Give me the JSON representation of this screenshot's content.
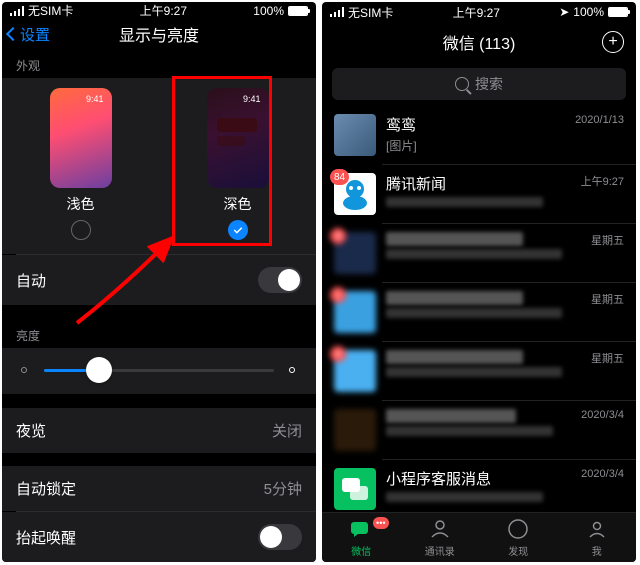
{
  "left": {
    "status": {
      "carrier": "无SIM卡",
      "time": "上午9:27",
      "battery": "100%"
    },
    "nav": {
      "back": "设置",
      "title": "显示与亮度"
    },
    "appearance": {
      "section": "外观",
      "light": {
        "label": "浅色",
        "time": "9:41"
      },
      "dark": {
        "label": "深色",
        "time": "9:41"
      }
    },
    "auto_row": "自动",
    "brightness_section": "亮度",
    "night_shift": {
      "label": "夜览",
      "value": "关闭"
    },
    "auto_lock": {
      "label": "自动锁定",
      "value": "5分钟"
    },
    "raise_to_wake": "抬起唤醒"
  },
  "right": {
    "status": {
      "carrier": "无SIM卡",
      "time": "上午9:27",
      "battery": "100%"
    },
    "nav_title": "微信 (113)",
    "search_placeholder": "搜索",
    "chats": [
      {
        "name": "鸾鸾",
        "sub": "[图片]",
        "time": "2020/1/13",
        "avatar_bg": "linear-gradient(135deg,#6a8caf,#3a5a7a)",
        "badge": ""
      },
      {
        "name": "腾讯新闻",
        "sub": "",
        "time": "上午9:27",
        "avatar_bg": "#fff",
        "badge": "84",
        "icon": "tx"
      },
      {
        "name": "",
        "sub": "",
        "time": "星期五",
        "avatar_bg": "#1a2a4a",
        "badge": "4",
        "blur": true
      },
      {
        "name": "",
        "sub": "",
        "time": "星期五",
        "avatar_bg": "#3aa0e0",
        "badge": "1",
        "blur": true
      },
      {
        "name": "",
        "sub": "",
        "time": "星期五",
        "avatar_bg": "#4ab0f0",
        "badge": "4",
        "blur": true
      },
      {
        "name": "",
        "sub": "",
        "time": "2020/3/4",
        "avatar_bg": "#2a1a0a",
        "badge": "",
        "blur": true
      },
      {
        "name": "小程序客服消息",
        "sub": "",
        "time": "2020/3/4",
        "avatar_bg": "#07c160",
        "badge": "",
        "icon": "mp"
      }
    ],
    "tabs": {
      "wechat": "微信",
      "contacts": "通讯录",
      "discover": "发现",
      "me": "我",
      "badge": "•••"
    }
  }
}
